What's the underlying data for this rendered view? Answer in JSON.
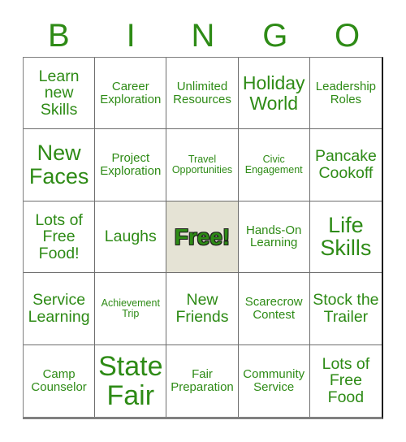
{
  "header": {
    "letters": [
      "B",
      "I",
      "N",
      "G",
      "O"
    ]
  },
  "colors": {
    "text_green": "#2e8b16",
    "free_cell_background": "#e5e3d5",
    "grid_line": "#6e6e6e",
    "page_background": "#ffffff"
  },
  "grid": {
    "rows": 5,
    "columns": 5,
    "cells": [
      {
        "label": "Learn new Skills",
        "size": "md",
        "free": false
      },
      {
        "label": "Career Exploration",
        "size": "sm",
        "free": false
      },
      {
        "label": "Unlimited Resources",
        "size": "sm",
        "free": false
      },
      {
        "label": "Holiday World",
        "size": "lg",
        "free": false
      },
      {
        "label": "Leadership Roles",
        "size": "sm",
        "free": false
      },
      {
        "label": "New Faces",
        "size": "xl",
        "free": false
      },
      {
        "label": "Project Exploration",
        "size": "sm",
        "free": false
      },
      {
        "label": "Travel Opportunities",
        "size": "xs",
        "free": false
      },
      {
        "label": "Civic Engagement",
        "size": "xs",
        "free": false
      },
      {
        "label": "Pancake Cookoff",
        "size": "md",
        "free": false
      },
      {
        "label": "Lots of Free Food!",
        "size": "md",
        "free": false
      },
      {
        "label": "Laughs",
        "size": "md",
        "free": false
      },
      {
        "label": "Free!",
        "size": "free",
        "free": true
      },
      {
        "label": "Hands-On Learning",
        "size": "sm",
        "free": false
      },
      {
        "label": "Life Skills",
        "size": "xl",
        "free": false
      },
      {
        "label": "Service Learning",
        "size": "md",
        "free": false
      },
      {
        "label": "Achievement Trip",
        "size": "xs",
        "free": false
      },
      {
        "label": "New Friends",
        "size": "md",
        "free": false
      },
      {
        "label": "Scarecrow Contest",
        "size": "sm",
        "free": false
      },
      {
        "label": "Stock the Trailer",
        "size": "md",
        "free": false
      },
      {
        "label": "Camp Counselor",
        "size": "sm",
        "free": false
      },
      {
        "label": "State Fair",
        "size": "xxl",
        "free": false
      },
      {
        "label": "Fair Preparation",
        "size": "sm",
        "free": false
      },
      {
        "label": "Community Service",
        "size": "sm",
        "free": false
      },
      {
        "label": "Lots of Free Food",
        "size": "md",
        "free": false
      }
    ]
  }
}
